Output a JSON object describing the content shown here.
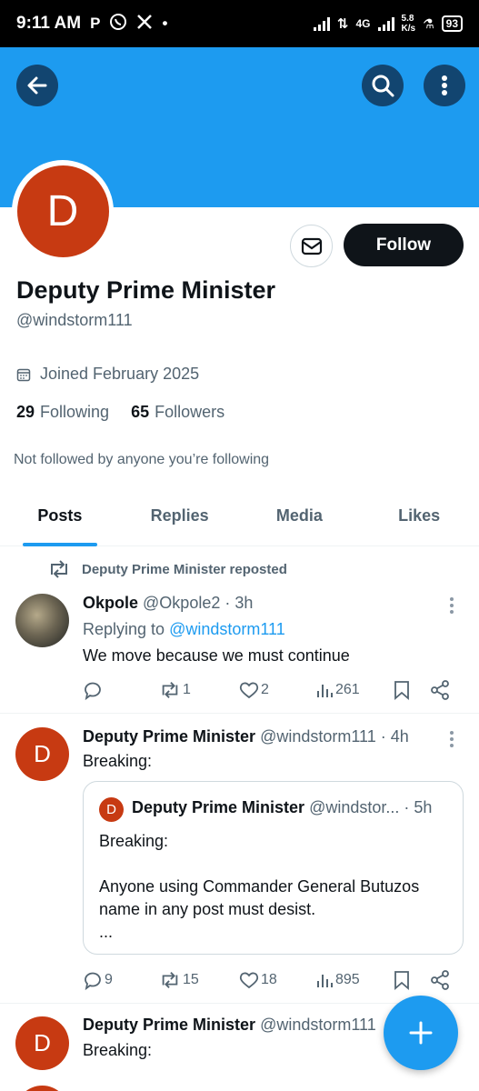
{
  "status": {
    "time": "9:11 AM",
    "net_type": "4G",
    "speed": "5.8",
    "speed_unit": "K/s",
    "battery": "93"
  },
  "profile": {
    "initial": "D",
    "name": "Deputy Prime Minister",
    "handle": "@windstorm111",
    "joined": "Joined February 2025",
    "following_count": "29",
    "following_label": "Following",
    "followers_count": "65",
    "followers_label": "Followers",
    "not_followed": "Not followed by anyone you’re following",
    "follow_label": "Follow"
  },
  "tabs": [
    {
      "label": "Posts"
    },
    {
      "label": "Replies"
    },
    {
      "label": "Media"
    },
    {
      "label": "Likes"
    }
  ],
  "posts": [
    {
      "repost_text": "Deputy Prime Minister reposted",
      "author": "Okpole",
      "handle": "@Okpole2",
      "time": "· 3h",
      "replying_prefix": "Replying to",
      "replying_handle": "@windstorm111",
      "text": "We move because we must continue",
      "replies": "",
      "reposts": "1",
      "likes": "2",
      "views": "261"
    },
    {
      "initial": "D",
      "author": "Deputy Prime Minister",
      "handle": "@windstorm111",
      "time": "· 4h",
      "text": "Breaking:",
      "quote": {
        "initial": "D",
        "author": "Deputy Prime Minister",
        "handle": "@windstor...",
        "time": "· 5h",
        "line1": "Breaking:",
        "line2": "Anyone using Commander General Butuzos name in any post must desist.",
        "line3": "..."
      },
      "replies": "9",
      "reposts": "15",
      "likes": "18",
      "views": "895"
    },
    {
      "initial": "D",
      "author": "Deputy Prime Minister",
      "handle": "@windstorm111",
      "text": "Breaking:"
    }
  ],
  "colors": {
    "accent": "#1d9bf0",
    "avatar": "#c73a12",
    "text": "#0f1419",
    "muted": "#536471"
  }
}
